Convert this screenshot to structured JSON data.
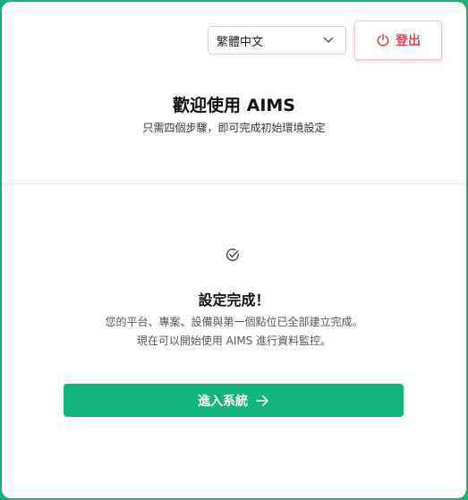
{
  "header": {
    "language_select": {
      "value": "繁體中文",
      "icon": "chevron-down-icon"
    },
    "logout_button": {
      "label": "登出",
      "icon": "power-icon",
      "color": "#e0434d"
    }
  },
  "welcome": {
    "title": "歡迎使用 AIMS",
    "subtitle": "只需四個步驟，即可完成初始環境設定"
  },
  "completion": {
    "icon": "check-circle-icon",
    "title": "設定完成！",
    "line1": "您的平台、專案、設備與第一個點位已全部建立完成。",
    "line2": "現在可以開始使用 AIMS 進行資料監控。"
  },
  "enter_button": {
    "label": "進入系統",
    "icon": "arrow-right-icon",
    "color": "#12b57f"
  },
  "colors": {
    "frame": "#1ab077",
    "accent": "#12b57f",
    "danger": "#e0434d"
  }
}
